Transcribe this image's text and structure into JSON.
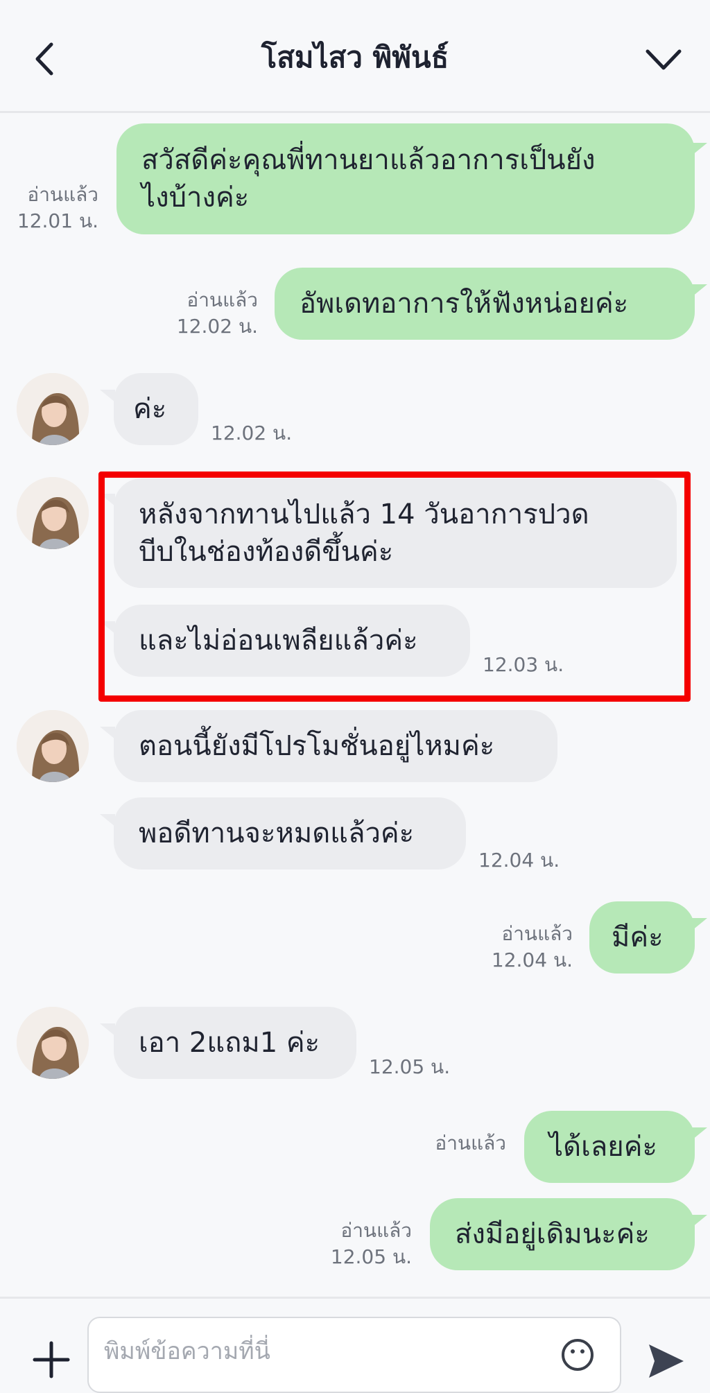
{
  "header": {
    "title": "โสมไสว พิพันธ์"
  },
  "messages": [
    {
      "side": "me",
      "text": "สวัสดีค่ะคุณพี่ทานยาแล้วอาการเป็นยัง\nไงบ้างค่ะ",
      "read": "อ่านแล้ว",
      "time": "12.01 น."
    },
    {
      "side": "me",
      "text": "อัพเดทอาการให้ฟังหน่อยค่ะ",
      "read": "อ่านแล้ว",
      "time": "12.02 น."
    },
    {
      "side": "them",
      "text": "ค่ะ",
      "time": "12.02 น."
    },
    {
      "side": "them",
      "text": "หลังจากทานไปแล้ว 14 วันอาการปวด\nบีบในช่องท้องดีขึ้นค่ะ"
    },
    {
      "side": "them",
      "text": "และไม่อ่อนเพลียแล้วค่ะ",
      "time": "12.03 น."
    },
    {
      "side": "them",
      "text": "ตอนนี้ยังมีโปรโมชั่นอยู่ไหมค่ะ"
    },
    {
      "side": "them",
      "text": "พอดีทานจะหมดแล้วค่ะ",
      "time": "12.04 น."
    },
    {
      "side": "me",
      "text": "มีค่ะ",
      "read": "อ่านแล้ว",
      "time": "12.04 น."
    },
    {
      "side": "them",
      "text": "เอา 2แถม1 ค่ะ",
      "time": "12.05 น."
    },
    {
      "side": "me",
      "text": "ได้เลยค่ะ",
      "read": "อ่านแล้ว"
    },
    {
      "side": "me",
      "text": "ส่งมีอยู่เดิมนะค่ะ",
      "read": "อ่านแล้ว",
      "time": "12.05 น."
    }
  ],
  "composer": {
    "placeholder": "พิมพ์ข้อความที่นี่"
  },
  "colors": {
    "my_bubble": "#b6e8b7",
    "their_bubble": "#ebecef",
    "highlight_box": "#f40000",
    "background": "#f7f8fa"
  },
  "icons": {
    "back": "chevron-left-icon",
    "menu": "chevron-down-icon",
    "add": "plus-icon",
    "emoji": "smiley-icon",
    "send": "send-icon"
  }
}
